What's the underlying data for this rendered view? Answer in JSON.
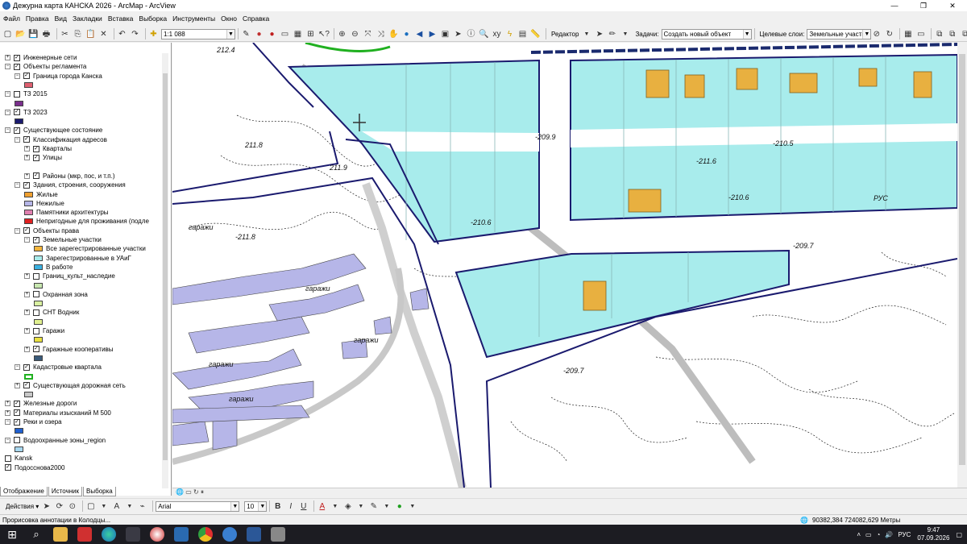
{
  "window": {
    "title": "Дежурна карта КАНСКА 2026 - ArcMap - ArcView",
    "controls": [
      "—",
      "❐",
      "✕"
    ]
  },
  "menu": [
    "Файл",
    "Правка",
    "Вид",
    "Закладки",
    "Вставка",
    "Выборка",
    "Инструменты",
    "Окно",
    "Справка"
  ],
  "toolbar": {
    "scale": "1:1 088",
    "editor_label": "Редактор",
    "tasks_label": "Задачи:",
    "task_value": "Создать новый объект",
    "target_label": "Целевые слои:",
    "target_value": "Земельные участки"
  },
  "toc": {
    "rows": [
      {
        "pm": "+",
        "cb": true,
        "indent": 0,
        "label": "Инженерные сети"
      },
      {
        "pm": "−",
        "cb": true,
        "indent": 0,
        "label": "Объекты регламента"
      },
      {
        "pm": "−",
        "cb": true,
        "indent": 1,
        "label": "Граница города Канска"
      },
      {
        "swatch": "#e06070",
        "indent": 2,
        "label": ""
      },
      {
        "pm": "−",
        "cb": false,
        "indent": 0,
        "label": "ТЗ 2015"
      },
      {
        "swatch": "#7a2e8c",
        "indent": 1,
        "label": ""
      },
      {
        "pm": "−",
        "cb": true,
        "indent": 0,
        "label": "ТЗ 2023"
      },
      {
        "swatch": "#1a1a6e",
        "indent": 1,
        "label": ""
      },
      {
        "pm": "−",
        "cb": true,
        "indent": 0,
        "label": "Существующее состояние"
      },
      {
        "pm": "−",
        "cb": true,
        "indent": 1,
        "label": "Классификация адресов"
      },
      {
        "pm": "+",
        "cb": true,
        "indent": 2,
        "label": "Кварталы"
      },
      {
        "pm": "+",
        "cb": true,
        "indent": 2,
        "label": "Улицы"
      },
      {
        "gap": true
      },
      {
        "pm": "+",
        "cb": true,
        "indent": 2,
        "label": "Районы (мкр, пос, и т.п.)"
      },
      {
        "pm": "−",
        "cb": true,
        "indent": 1,
        "label": "Здания, строения, сооружения"
      },
      {
        "swatch": "#f0a030",
        "indent": 2,
        "label": "Жилые"
      },
      {
        "swatch": "#b6b6e8",
        "indent": 2,
        "label": "Нежилые"
      },
      {
        "swatch": "#e080b0",
        "indent": 2,
        "label": "Памятники архитектуры"
      },
      {
        "swatch": "#e02020",
        "indent": 2,
        "label": "Непригодные для проживания (подле"
      },
      {
        "pm": "−",
        "cb": true,
        "indent": 1,
        "label": "Объекты права"
      },
      {
        "pm": "−",
        "cb": true,
        "indent": 2,
        "label": "Земельные участки"
      },
      {
        "swatch": "#f3b53c",
        "indent": 3,
        "label": "Все зарегестрированные участки"
      },
      {
        "swatch": "#a8ecec",
        "indent": 3,
        "label": "Зарегестрированные в УАиГ"
      },
      {
        "swatch": "#3ab0e0",
        "indent": 3,
        "label": "В работе"
      },
      {
        "pm": "+",
        "cb": false,
        "indent": 2,
        "label": "Границ_культ_наследие"
      },
      {
        "swatch": "#c8e8b0",
        "indent": 3,
        "label": ""
      },
      {
        "pm": "+",
        "cb": false,
        "indent": 2,
        "label": "Охранная зона"
      },
      {
        "swatch": "#d8f0a0",
        "indent": 3,
        "label": ""
      },
      {
        "pm": "+",
        "cb": false,
        "indent": 2,
        "label": "СНТ Водник"
      },
      {
        "swatch": "#e0f090",
        "indent": 3,
        "label": ""
      },
      {
        "pm": "+",
        "cb": false,
        "indent": 2,
        "label": "Гаражи"
      },
      {
        "swatch": "#e8e040",
        "indent": 3,
        "label": ""
      },
      {
        "pm": "+",
        "cb": true,
        "indent": 2,
        "label": "Гаражные кооперативы"
      },
      {
        "swatch": "#3a5a7a",
        "indent": 3,
        "label": ""
      },
      {
        "pm": "−",
        "cb": true,
        "indent": 1,
        "label": "Кадастровые квартала"
      },
      {
        "swatch": "#ffffff",
        "border": "#20b020",
        "indent": 2,
        "label": ""
      },
      {
        "pm": "+",
        "cb": true,
        "indent": 1,
        "label": "Существующая дорожная сеть"
      },
      {
        "swatch": "#c8c8c8",
        "indent": 2,
        "label": ""
      },
      {
        "pm": "+",
        "cb": true,
        "indent": 0,
        "label": "Железные дороги"
      },
      {
        "pm": "+",
        "cb": true,
        "indent": 0,
        "label": "Материалы изысканий М 500"
      },
      {
        "pm": "−",
        "cb": true,
        "indent": 0,
        "label": "Реки и озера"
      },
      {
        "swatch": "#2060d0",
        "indent": 1,
        "label": ""
      },
      {
        "pm": "−",
        "cb": false,
        "indent": 0,
        "label": "Водоохранные зоны_region"
      },
      {
        "swatch": "#a8d8f0",
        "indent": 1,
        "label": ""
      },
      {
        "cb": false,
        "indent": 0,
        "label": "Kansk"
      },
      {
        "cb": true,
        "indent": 0,
        "label": "Подосснова2000"
      }
    ],
    "tabs": [
      "Отображение",
      "Источник",
      "Выборка"
    ]
  },
  "map": {
    "labels": [
      "212.4",
      "211.8",
      "211.9",
      "-209.9",
      "-210.6",
      "-210.5",
      "-211.6",
      "-210.6",
      "-211.8",
      "-209.7",
      "-209.7",
      "гаражи",
      "гаражи",
      "гаражи",
      "гаражи",
      "гаражи",
      "РУС"
    ]
  },
  "drawbar": {
    "actions": "Действия ▾",
    "font": "Arial",
    "size": "10",
    "bold": "B",
    "italic": "I",
    "underline": "U"
  },
  "status": {
    "message": "Прорисовка аннотации в Колодцы...",
    "coords": "90382,384  724082,629 Метры"
  },
  "taskbar": {
    "lang": "РУС",
    "time": "9:47",
    "date": "07.09.2026"
  }
}
